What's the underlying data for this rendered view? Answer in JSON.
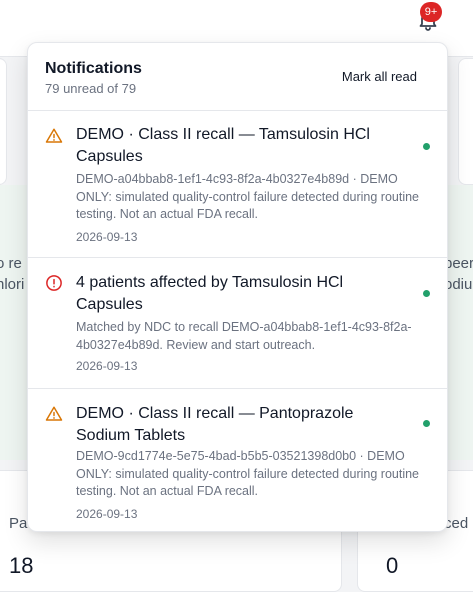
{
  "header": {
    "notification_badge": "9+"
  },
  "background": {
    "left_fragment_1": "o re",
    "left_fragment_2": "nlori",
    "right_fragment_1": "beer",
    "right_fragment_2": "odiu",
    "left_stat_label": "Pat",
    "left_stat_value": "18",
    "right_stat_label": "ced",
    "right_stat_value": "0"
  },
  "notifications": {
    "title": "Notifications",
    "subtitle": "79 unread of 79",
    "mark_all_read": "Mark all read",
    "items": [
      {
        "icon": "warning-triangle-icon",
        "title": "DEMO · Class II recall — Tamsulosin HCl Capsules",
        "body": "DEMO-a04bbab8-1ef1-4c93-8f2a-4b0327e4b89d · DEMO ONLY: simulated quality-control failure detected during routine testing. Not an actual FDA recall.",
        "date": "2026-09-13",
        "unread": true
      },
      {
        "icon": "alert-circle-icon",
        "title": "4 patients affected by Tamsulosin HCl Capsules",
        "body": "Matched by NDC to recall DEMO-a04bbab8-1ef1-4c93-8f2a-4b0327e4b89d. Review and start outreach.",
        "date": "2026-09-13",
        "unread": true
      },
      {
        "icon": "warning-triangle-icon",
        "title": "DEMO · Class II recall — Pantoprazole Sodium Tablets",
        "body": "DEMO-9cd1774e-5e75-4bad-b5b5-03521398d0b0 · DEMO ONLY: simulated quality-control failure detected during routine testing. Not an actual FDA recall.",
        "date": "2026-09-13",
        "unread": true
      }
    ]
  },
  "colors": {
    "warning": "#d97706",
    "alert": "#dc2626",
    "unread_dot": "#22a06b",
    "badge": "#dc2626"
  }
}
